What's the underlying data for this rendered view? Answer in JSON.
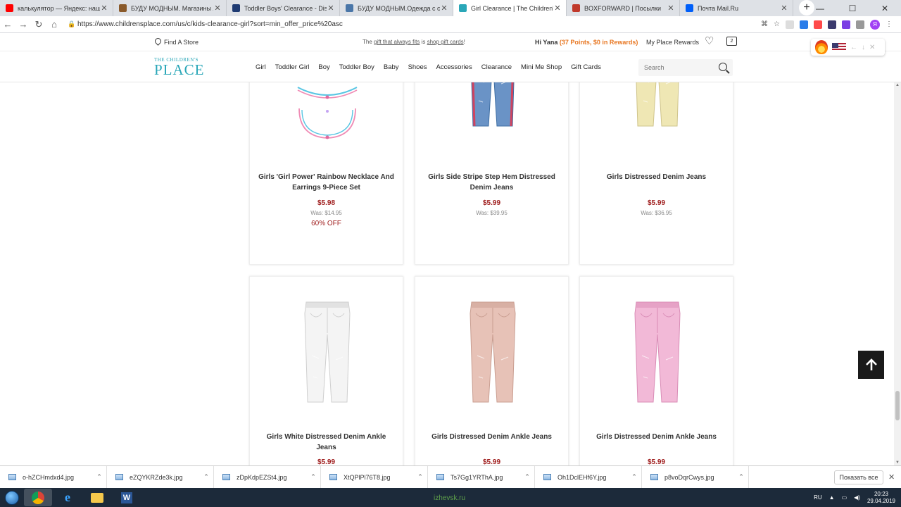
{
  "browser": {
    "tabs": [
      {
        "title": "калькулятор — Яндекс: нашлос",
        "fav": "Я",
        "color": "#ff0000",
        "active": false
      },
      {
        "title": "БУДУ МОДНЫМ. Магазины Аме",
        "fav": "M",
        "color": "#8a5a2b",
        "active": false
      },
      {
        "title": "Toddler Boys' Clearance - Discou",
        "fav": "C",
        "color": "#1f3b73",
        "active": false
      },
      {
        "title": "БУДУ МОДНЫМ.Одежда с сайто",
        "fav": "B",
        "color": "#4a76a8",
        "active": false
      },
      {
        "title": "Girl Clearance | The Children's Pl",
        "fav": "C",
        "color": "#2aa7b8",
        "active": true
      },
      {
        "title": "BOXFORWARD | Посылки",
        "fav": "B",
        "color": "#c0392b",
        "active": false
      },
      {
        "title": "Почта Mail.Ru",
        "fav": "@",
        "color": "#005ff9",
        "active": false
      }
    ],
    "url": "https://www.childrensplace.com/us/c/kids-clearance-girl?sort=min_offer_price%20asc"
  },
  "utility": {
    "find_store": "Find A Store",
    "promo_lead": "The ",
    "promo_link1": "gift that always fits",
    "promo_mid": " is ",
    "promo_link2": "shop gift cards",
    "promo_end": "!",
    "greeting": "Hi Yana ",
    "points": "(37 Points, $0 in Rewards)",
    "rewards": "My Place Rewards",
    "bag_count": "2"
  },
  "nav": {
    "logo_small": "THE CHILDREN'S",
    "logo_big": "PLACE",
    "links": [
      "Girl",
      "Toddler Girl",
      "Boy",
      "Toddler Boy",
      "Baby",
      "Shoes",
      "Accessories",
      "Clearance",
      "Mini Me Shop",
      "Gift Cards"
    ],
    "search_placeholder": "Search"
  },
  "products": [
    {
      "name": "Girls 'Girl Power' Rainbow Necklace And Earrings 9-Piece Set",
      "price": "$5.98",
      "was": "Was: $14.95",
      "off": "60% OFF",
      "kind": "necklace"
    },
    {
      "name": "Girls Side Stripe Step Hem Distressed Denim Jeans",
      "price": "$5.99",
      "was": "Was: $39.95",
      "off": "",
      "kind": "jeans-blue"
    },
    {
      "name": "Girls Distressed Denim Jeans",
      "price": "$5.99",
      "was": "Was: $36.95",
      "off": "",
      "kind": "jeans-yellow"
    },
    {
      "name": "Girls White Distressed Denim Ankle Jeans",
      "price": "$5.99",
      "was": "",
      "off": "",
      "kind": "jeans-white"
    },
    {
      "name": "Girls Distressed Denim Ankle Jeans",
      "price": "$5.99",
      "was": "",
      "off": "",
      "kind": "jeans-blush"
    },
    {
      "name": "Girls Distressed Denim Ankle Jeans",
      "price": "$5.99",
      "was": "",
      "off": "",
      "kind": "jeans-pink"
    }
  ],
  "colors": {
    "price_red": "#a01f1f",
    "brand_teal": "#2aa7b8",
    "points_orange": "#e87722"
  },
  "downloads": {
    "files": [
      "o-hZCHmdxd4.jpg",
      "eZQYKRZde3k.jpg",
      "zDpKdpEZSt4.jpg",
      "XtQPlPl76T8.jpg",
      "Ts7Gg1YRThA.jpg",
      "Oh1DclEHf6Y.jpg",
      "p8voDqrCwys.jpg"
    ],
    "show_all": "Показать все"
  },
  "taskbar": {
    "watermark": "izhevsk.ru",
    "lang": "RU",
    "time": "20:23",
    "date": "29.04.2019"
  }
}
